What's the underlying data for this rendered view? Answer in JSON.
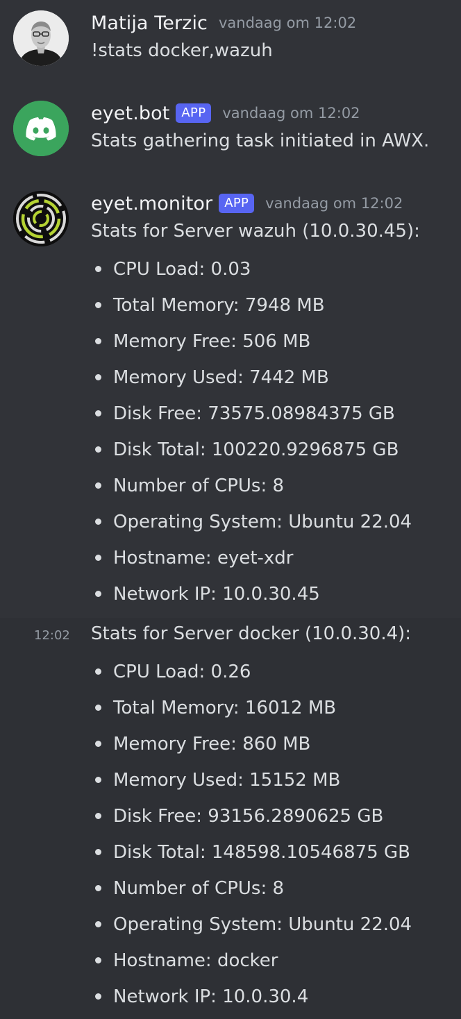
{
  "messages": [
    {
      "author": "Matija Terzic",
      "timestamp": "vandaag om 12:02",
      "text": "!stats docker,wazuh"
    },
    {
      "author": "eyet.bot",
      "badge": "APP",
      "timestamp": "vandaag om 12:02",
      "text": "Stats gathering task initiated in AWX."
    },
    {
      "author": "eyet.monitor",
      "badge": "APP",
      "timestamp": "vandaag om 12:02",
      "title": "Stats for Server wazuh (10.0.30.45):",
      "items": [
        "CPU Load: 0.03",
        "Total Memory: 7948 MB",
        "Memory Free: 506 MB",
        "Memory Used: 7442 MB",
        "Disk Free: 73575.08984375 GB",
        "Disk Total: 100220.9296875 GB",
        "Number of CPUs: 8",
        "Operating System: Ubuntu 22.04",
        "Hostname: eyet-xdr",
        "Network IP: 10.0.30.45"
      ]
    },
    {
      "side_time": "12:02",
      "title": "Stats for Server docker (10.0.30.4):",
      "items": [
        "CPU Load: 0.26",
        "Total Memory: 16012 MB",
        "Memory Free: 860 MB",
        "Memory Used: 15152 MB",
        "Disk Free: 93156.2890625 GB",
        "Disk Total: 148598.10546875 GB",
        "Number of CPUs: 8",
        "Operating System: Ubuntu 22.04",
        "Hostname: docker",
        "Network IP: 10.0.30.4"
      ]
    }
  ],
  "icons": {
    "user_avatar": "person-photo-avatar",
    "bot_avatar": "discord-logo-icon",
    "monitor_avatar": "concentric-rings-logo-icon"
  },
  "colors": {
    "background": "#313338",
    "hover_background": "#2e3035",
    "app_badge": "#5865f2",
    "discord_green": "#3ba55d",
    "monitor_ring": "#b5d333"
  }
}
